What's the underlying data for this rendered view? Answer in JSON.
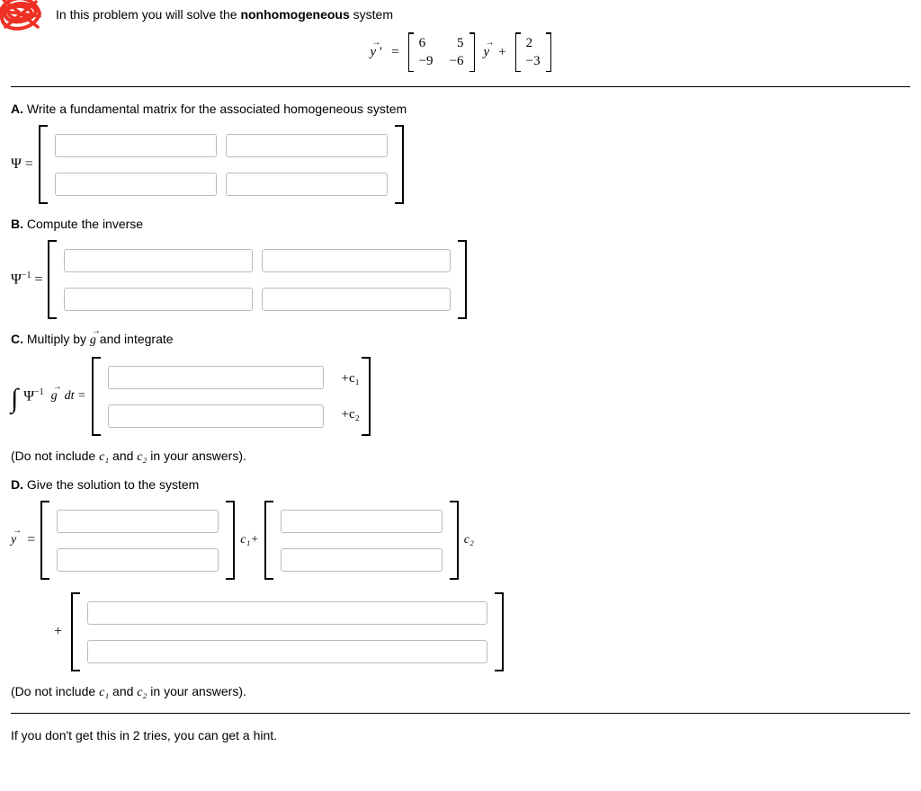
{
  "intro_prefix": "In this problem you will solve the ",
  "intro_bold": "nonhomogeneous",
  "intro_suffix": " system",
  "equation": {
    "lhs": "y⃗ ′",
    "eq": " = ",
    "A": [
      [
        "6",
        "5"
      ],
      [
        "−9",
        "−6"
      ]
    ],
    "mid": " y⃗ + ",
    "b": [
      "2",
      "−3"
    ]
  },
  "A": {
    "label_bold": "A.",
    "label_text": " Write a fundamental matrix for the associated homogeneous system",
    "lhs": "Ψ  ="
  },
  "B": {
    "label_bold": "B.",
    "label_text": " Compute the inverse",
    "lhs_psi": "Ψ",
    "lhs_sup": "−1",
    "lhs_eq": "  ="
  },
  "C": {
    "label_bold": "C.",
    "label_text": " Multiply by g⃗ and integrate",
    "int": "∫",
    "psi": "Ψ",
    "sup": "−1",
    "g": "g⃗",
    "dt": " dt  =",
    "plus_c1": "+c₁",
    "plus_c2": "+c₂",
    "note_pre": "(Do not include ",
    "c1": "c₁",
    "and": " and ",
    "c2": "c₂",
    "note_post": " in your answers)."
  },
  "D": {
    "label_bold": "D.",
    "label_text": " Give the solution to the system",
    "lhs": "y⃗  =",
    "c1plus": "c₁+",
    "c2": "c₂",
    "plus": "+",
    "note_pre": "(Do not include ",
    "nc1": "c₁",
    "and": " and ",
    "nc2": "c₂",
    "note_post": " in your answers)."
  },
  "hint": "If you don't get this in 2 tries, you can get a hint."
}
